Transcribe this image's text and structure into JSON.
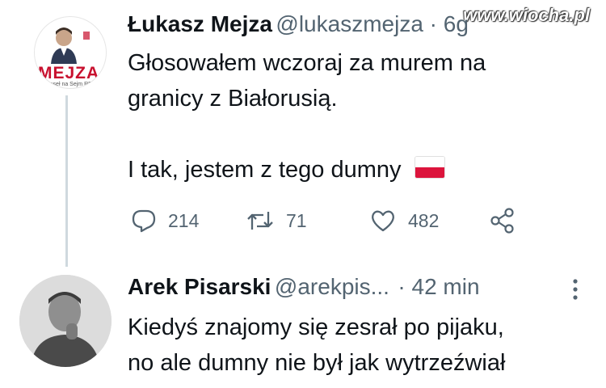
{
  "watermark": "www.wiocha.pl",
  "tweet": {
    "author_name": "Łukasz Mejza",
    "author_handle": "@lukaszmejza · 6g",
    "avatar_word": "MEJZA",
    "avatar_sub": "Poseł na Sejm RP",
    "lines": [
      "Głosowałem wczoraj za murem na",
      "granicy z Białorusią.",
      "",
      "I tak, jestem z tego dumny"
    ],
    "replies": "214",
    "retweets": "71",
    "likes": "482"
  },
  "reply": {
    "author_name": "Arek Pisarski",
    "author_handle": "@arekpis...",
    "time": "· 42 min",
    "lines": [
      "Kiedyś znajomy się zesrał po pijaku,",
      "no ale dumny nie był jak wytrzeźwiał"
    ]
  },
  "icons": [
    "reply-icon",
    "retweet-icon",
    "like-icon",
    "share-icon",
    "more-icon",
    "poland-flag-icon"
  ],
  "colors": {
    "name_text": "#0f1419",
    "secondary_text": "#536471",
    "thread_line": "#cfd9de",
    "brand_red": "#c8102e"
  }
}
